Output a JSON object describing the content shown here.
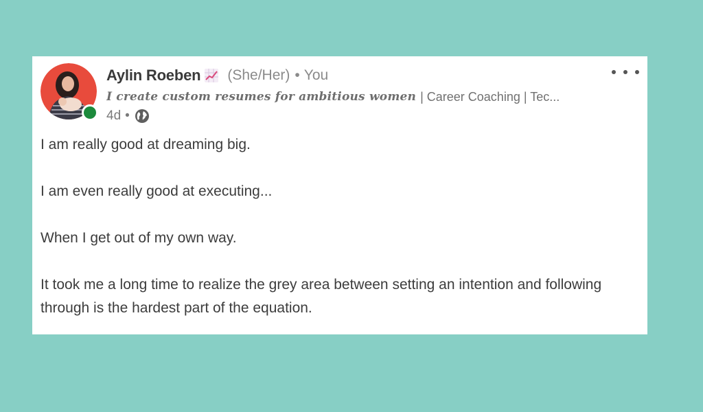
{
  "post": {
    "author": {
      "name": "Aylin Roeben",
      "name_emoji_icon": "chart-increasing-icon",
      "pronouns": "(She/Her)",
      "separator": "•",
      "relation": "You"
    },
    "headline": {
      "italic_part": "I create custom resumes for ambitious women",
      "rest": "| Career Coaching | Tec..."
    },
    "meta": {
      "age": "4d",
      "separator": "•",
      "visibility_icon": "globe-icon"
    },
    "more_icon": "ellipsis-icon",
    "body": {
      "paragraphs": [
        "I am really good at dreaming big.",
        "I am even really good at executing...",
        "When I get out of my own way.",
        "It took me a long time to realize the grey area between setting an intention and following through is the hardest part of the equation."
      ]
    }
  },
  "colors": {
    "page_background": "#87cfc5",
    "card_background": "#ffffff",
    "online_status": "#1c8a3c",
    "avatar_ring": "#e84b3c"
  }
}
